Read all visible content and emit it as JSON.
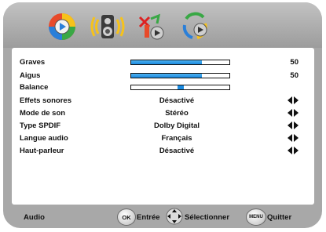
{
  "tabs": [
    {
      "icon": "picture-icon"
    },
    {
      "icon": "audio-speaker-icon"
    },
    {
      "icon": "feature-tools-icon"
    },
    {
      "icon": "setup-icon"
    }
  ],
  "rows": [
    {
      "label": "Graves",
      "value": "",
      "number": "50",
      "level": 0.72
    },
    {
      "label": "Aigus",
      "value": "",
      "number": "50",
      "level": 0.72
    },
    {
      "label": "Balance",
      "value": "",
      "number": "",
      "balance": 0
    },
    {
      "label": "Effets sonores",
      "value": "Désactivé",
      "arrows": "left-right-arrows-icon"
    },
    {
      "label": "Mode de son",
      "value": "Stéréo",
      "arrows": "left-right-arrows-icon"
    },
    {
      "label": "Type SPDIF",
      "value": "Dolby Digital",
      "arrows": "left-right-arrows-icon"
    },
    {
      "label": "Langue audio",
      "value": "Français",
      "arrows": "left-right-arrows-icon"
    },
    {
      "label": "Haut-parleur",
      "value": "Désactivé",
      "arrows": "left-right-arrows-icon"
    }
  ],
  "footer": {
    "menu_name": "Audio",
    "ok_button": "OK",
    "ok_label": "Entrée",
    "select_label": "Sélectionner",
    "menu_button": "MENU",
    "quit_label": "Quitter"
  },
  "colors": {
    "accent": "#1a8ae0",
    "frame": "#a8a8a8"
  }
}
